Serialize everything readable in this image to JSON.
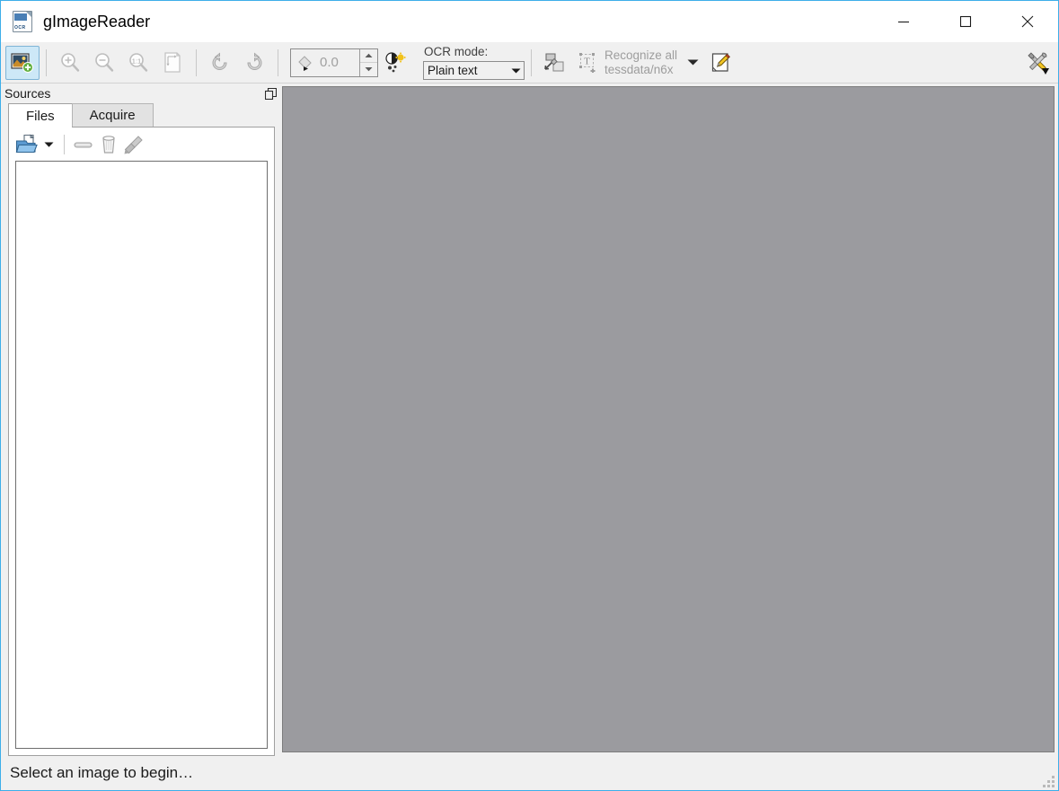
{
  "window": {
    "title": "gImageReader",
    "icon": "app-document-ocr-icon",
    "controls": {
      "minimize": "minimize-icon",
      "maximize": "maximize-icon",
      "close": "close-icon"
    }
  },
  "toolbar": {
    "add_image_label": "add-image-icon",
    "zoom_in_label": "zoom-in-icon",
    "zoom_out_label": "zoom-out-icon",
    "zoom_original_label": "zoom-one-to-one-icon",
    "fit_page_label": "fit-page-icon",
    "rotate_left_label": "rotate-left-icon",
    "rotate_right_label": "rotate-right-icon",
    "rotation": {
      "value": "0.0",
      "icon": "rotate-angle-icon"
    },
    "brightness_contrast_icon": "brightness-contrast-icon",
    "ocr_mode": {
      "label": "OCR mode:",
      "selected": "Plain text",
      "options": [
        "Plain text"
      ]
    },
    "autolayout_icon": "auto-layout-icon",
    "recognize": {
      "icon": "recognize-text-icon",
      "line1": "Recognize all",
      "line2": "tessdata/n6x",
      "dropdown_icon": "chevron-down-icon"
    },
    "edit_icon": "pencil-edit-icon",
    "tools_icon": "tools-settings-icon"
  },
  "sources": {
    "title": "Sources",
    "undock_icon": "undock-icon",
    "tabs": [
      {
        "label": "Files",
        "active": true
      },
      {
        "label": "Acquire",
        "active": false
      }
    ],
    "file_toolbar": {
      "open_icon": "open-folder-icon",
      "open_dropdown_icon": "chevron-down-icon",
      "remove_icon": "remove-minus-icon",
      "delete_icon": "trash-bin-icon",
      "clear_icon": "broom-clear-icon"
    },
    "file_list_items": []
  },
  "canvas": {
    "background_color": "#9b9b9f",
    "content": ""
  },
  "statusbar": {
    "message": "Select an image to begin…",
    "grip_icon": "resize-grip-icon"
  },
  "colors": {
    "accent_border": "#3daee9",
    "toolbar_bg": "#f0f0f0",
    "active_tool_bg": "#cde8f7",
    "canvas_gray": "#9b9b9f",
    "disabled_text": "#9d9d9d"
  }
}
